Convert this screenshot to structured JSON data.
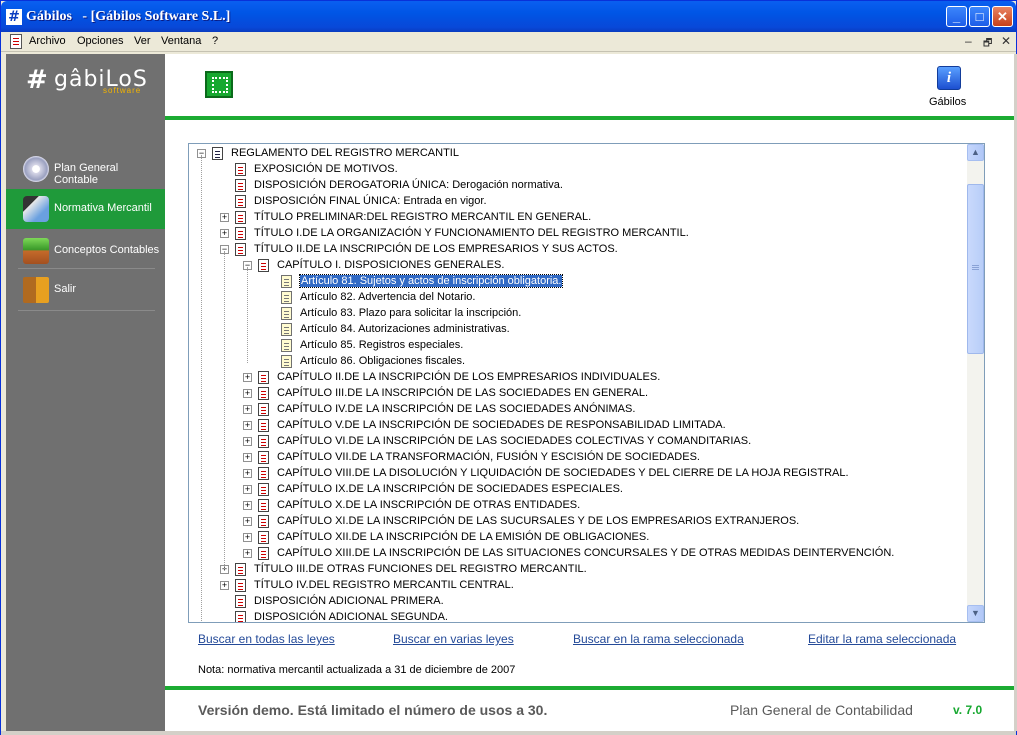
{
  "window": {
    "app_icon": "#",
    "title": "Gábilos   - [Gábilos Software S.L.]",
    "controls": {
      "minimize": "_",
      "maximize": "□",
      "close": "✕"
    }
  },
  "menubar": {
    "items": [
      "Archivo",
      "Opciones",
      "Ver",
      "Ventana",
      "?"
    ],
    "mdi_controls": {
      "minimize": "–",
      "restore": "🗗",
      "close": "✕"
    }
  },
  "sidebar": {
    "logo": {
      "hash": "#",
      "name": "gâbiLoS",
      "sub": "software"
    },
    "items": [
      {
        "label": "Plan General Contable",
        "icon": "disc-icon",
        "active": false
      },
      {
        "label": "Normativa Mercantil",
        "icon": "user-book-icon",
        "active": true
      },
      {
        "label": "Conceptos Contables",
        "icon": "books-icon",
        "active": false
      },
      {
        "label": "Salir",
        "icon": "exit-door-icon",
        "active": false
      }
    ]
  },
  "toolbar": {
    "info_label": "Gábilos",
    "info_glyph": "i"
  },
  "tree": {
    "rows": [
      {
        "text": "REGLAMENTO DEL REGISTRO MERCANTIL",
        "level": 0,
        "toggle": "−",
        "icon": "doc"
      },
      {
        "text": "EXPOSICIÓN DE MOTIVOS.",
        "level": 1,
        "toggle": "",
        "icon": "red"
      },
      {
        "text": "DISPOSICIÓN DEROGATORIA ÚNICA: Derogación normativa.",
        "level": 1,
        "toggle": "",
        "icon": "red"
      },
      {
        "text": "DISPOSICIÓN FINAL ÚNICA: Entrada en vigor.",
        "level": 1,
        "toggle": "",
        "icon": "red"
      },
      {
        "text": "TÍTULO PRELIMINAR:DEL REGISTRO MERCANTIL EN GENERAL.",
        "level": 1,
        "toggle": "+",
        "icon": "red"
      },
      {
        "text": "TÍTULO I.DE LA ORGANIZACIÓN Y FUNCIONAMIENTO DEL REGISTRO MERCANTIL.",
        "level": 1,
        "toggle": "+",
        "icon": "red"
      },
      {
        "text": "TÍTULO II.DE LA INSCRIPCIÓN DE LOS EMPRESARIOS Y SUS ACTOS.",
        "level": 1,
        "toggle": "−",
        "icon": "red"
      },
      {
        "text": "CAPÍTULO I. DISPOSICIONES GENERALES.",
        "level": 2,
        "toggle": "−",
        "icon": "red"
      },
      {
        "text": "Artículo 81. Sujetos y actos de inscripción obligatoria.",
        "level": 3,
        "toggle": "",
        "icon": "yel",
        "selected": true
      },
      {
        "text": "Artículo 82. Advertencia del Notario.",
        "level": 3,
        "toggle": "",
        "icon": "yel"
      },
      {
        "text": "Artículo 83. Plazo para solicitar la inscripción.",
        "level": 3,
        "toggle": "",
        "icon": "yel"
      },
      {
        "text": "Artículo 84. Autorizaciones administrativas.",
        "level": 3,
        "toggle": "",
        "icon": "yel"
      },
      {
        "text": "Artículo 85. Registros especiales.",
        "level": 3,
        "toggle": "",
        "icon": "yel"
      },
      {
        "text": "Artículo 86. Obligaciones fiscales.",
        "level": 3,
        "toggle": "",
        "icon": "yel"
      },
      {
        "text": "CAPÍTULO II.DE LA INSCRIPCIÓN DE LOS EMPRESARIOS INDIVIDUALES.",
        "level": 2,
        "toggle": "+",
        "icon": "red"
      },
      {
        "text": "CAPÍTULO III.DE LA INSCRIPCIÓN DE LAS SOCIEDADES EN GENERAL.",
        "level": 2,
        "toggle": "+",
        "icon": "red"
      },
      {
        "text": "CAPÍTULO IV.DE LA INSCRIPCIÓN DE LAS SOCIEDADES ANÓNIMAS.",
        "level": 2,
        "toggle": "+",
        "icon": "red"
      },
      {
        "text": "CAPÍTULO V.DE LA INSCRIPCIÓN DE SOCIEDADES DE RESPONSABILIDAD LIMITADA.",
        "level": 2,
        "toggle": "+",
        "icon": "red"
      },
      {
        "text": "CAPÍTULO VI.DE LA INSCRIPCIÓN DE LAS SOCIEDADES COLECTIVAS Y COMANDITARIAS.",
        "level": 2,
        "toggle": "+",
        "icon": "red"
      },
      {
        "text": "CAPÍTULO VII.DE LA TRANSFORMACIÓN, FUSIÓN Y ESCISIÓN DE SOCIEDADES.",
        "level": 2,
        "toggle": "+",
        "icon": "red"
      },
      {
        "text": "CAPÍTULO VIII.DE LA DISOLUCIÓN Y LIQUIDACIÓN DE SOCIEDADES Y DEL CIERRE DE LA HOJA REGISTRAL.",
        "level": 2,
        "toggle": "+",
        "icon": "red"
      },
      {
        "text": "CAPÍTULO IX.DE LA INSCRIPCIÓN DE SOCIEDADES ESPECIALES.",
        "level": 2,
        "toggle": "+",
        "icon": "red"
      },
      {
        "text": "CAPÍTULO X.DE LA INSCRIPCIÓN DE OTRAS ENTIDADES.",
        "level": 2,
        "toggle": "+",
        "icon": "red"
      },
      {
        "text": "CAPÍTULO XI.DE LA INSCRIPCIÓN DE LAS SUCURSALES Y DE LOS EMPRESARIOS EXTRANJEROS.",
        "level": 2,
        "toggle": "+",
        "icon": "red"
      },
      {
        "text": "CAPÍTULO XII.DE LA INSCRIPCIÓN DE LA EMISIÓN DE OBLIGACIONES.",
        "level": 2,
        "toggle": "+",
        "icon": "red"
      },
      {
        "text": "CAPÍTULO XIII.DE LA INSCRIPCIÓN DE LAS SITUACIONES CONCURSALES Y DE OTRAS MEDIDAS DEINTERVENCIÓN.",
        "level": 2,
        "toggle": "+",
        "icon": "red"
      },
      {
        "text": "TÍTULO III.DE OTRAS FUNCIONES DEL REGISTRO MERCANTIL.",
        "level": 1,
        "toggle": "+",
        "icon": "red"
      },
      {
        "text": "TÍTULO IV.DEL REGISTRO MERCANTIL CENTRAL.",
        "level": 1,
        "toggle": "+",
        "icon": "red"
      },
      {
        "text": "DISPOSICIÓN ADICIONAL PRIMERA.",
        "level": 1,
        "toggle": "",
        "icon": "red"
      },
      {
        "text": "DISPOSICIÓN ADICIONAL SEGUNDA.",
        "level": 1,
        "toggle": "",
        "icon": "red"
      }
    ],
    "scroll_up": "▲",
    "scroll_down": "▼"
  },
  "links": [
    "Buscar en todas las leyes",
    "Buscar en varias leyes",
    "Buscar en la rama seleccionada",
    "Editar la rama seleccionada"
  ],
  "note": "Nota: normativa mercantil actualizada a 31 de diciembre de 2007",
  "footer": {
    "demo": "Versión demo. Está limitado el número de usos a 30.",
    "product": "Plan General de Contabilidad",
    "version": "v. 7.0"
  },
  "colors": {
    "accent_green": "#1cab32",
    "sidebar_bg": "#707070",
    "selection": "#316ac5",
    "link": "#244a98"
  }
}
